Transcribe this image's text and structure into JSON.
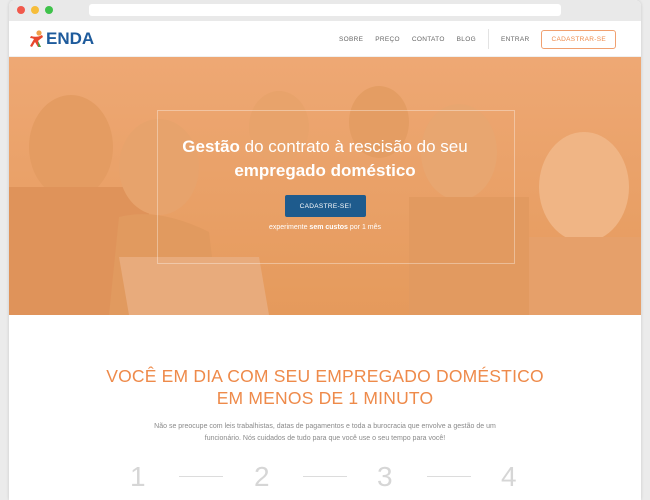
{
  "brand": {
    "name": "ENDA",
    "primary": "#1e5b9c",
    "accent": "#ee8a4a"
  },
  "nav": {
    "items": [
      "SOBRE",
      "PREÇO",
      "CONTATO",
      "BLOG"
    ],
    "login": "ENTRAR",
    "signup": "CADASTRAR-SE"
  },
  "hero": {
    "title_bold_1": "Gestão",
    "title_rest_1": " do contrato à rescisão do seu",
    "title_line_2": "empregado doméstico",
    "cta": "CADASTRE-SE!",
    "trial_pre": "experimente ",
    "trial_bold": "sem custos",
    "trial_post": " por 1 mês"
  },
  "section": {
    "title_line_1": "VOCÊ EM DIA COM SEU EMPREGADO DOMÉSTICO",
    "title_line_2": "EM MENOS DE 1 MINUTO",
    "text_line_1": "Não se preocupe com leis trabalhistas, datas de pagamentos e toda a burocracia que envolve a gestão de um",
    "text_line_2": "funcionário. Nós cuidados de tudo para que você use o seu tempo para você!",
    "steps": [
      "1",
      "2",
      "3",
      "4"
    ]
  }
}
